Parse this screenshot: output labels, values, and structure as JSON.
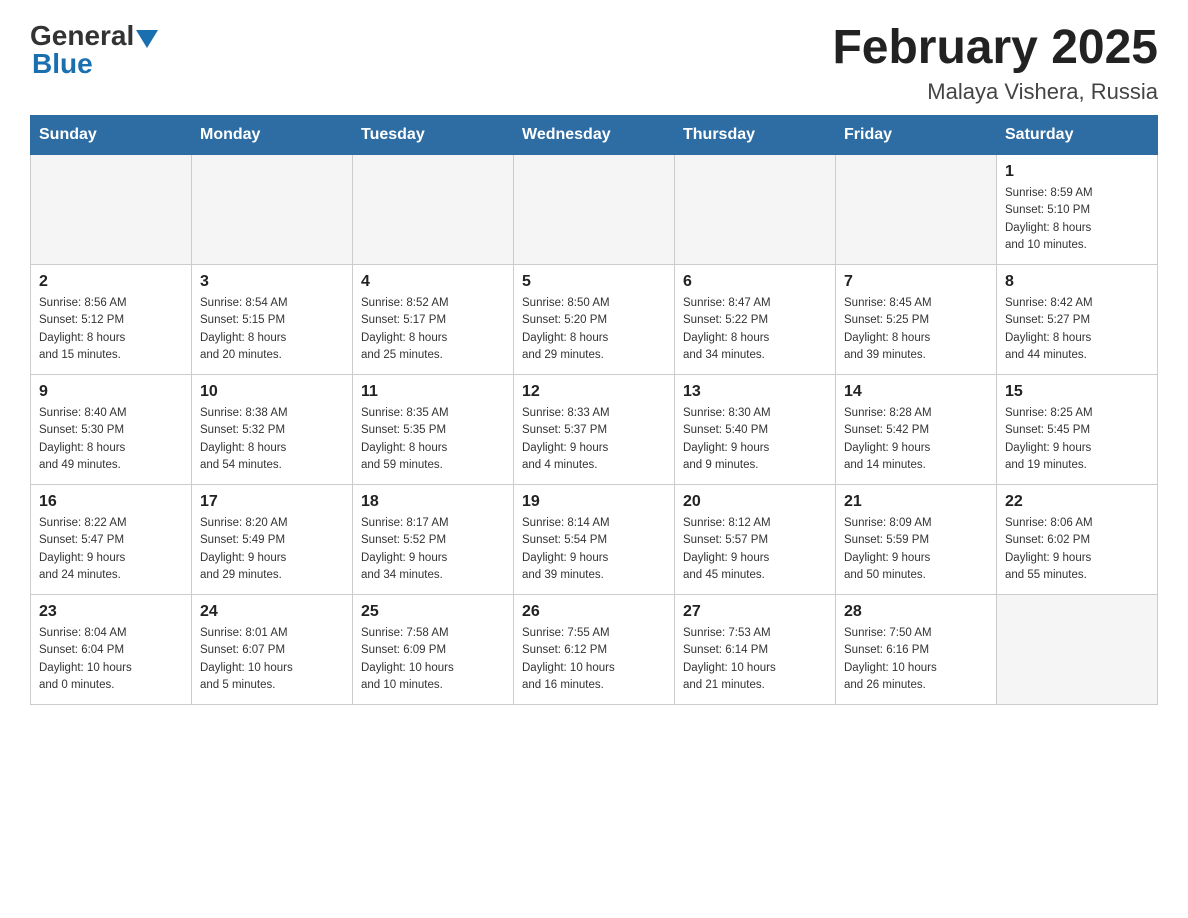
{
  "header": {
    "logo_general": "General",
    "logo_blue": "Blue",
    "month_title": "February 2025",
    "location": "Malaya Vishera, Russia"
  },
  "weekdays": [
    "Sunday",
    "Monday",
    "Tuesday",
    "Wednesday",
    "Thursday",
    "Friday",
    "Saturday"
  ],
  "weeks": [
    [
      {
        "day": "",
        "info": ""
      },
      {
        "day": "",
        "info": ""
      },
      {
        "day": "",
        "info": ""
      },
      {
        "day": "",
        "info": ""
      },
      {
        "day": "",
        "info": ""
      },
      {
        "day": "",
        "info": ""
      },
      {
        "day": "1",
        "info": "Sunrise: 8:59 AM\nSunset: 5:10 PM\nDaylight: 8 hours\nand 10 minutes."
      }
    ],
    [
      {
        "day": "2",
        "info": "Sunrise: 8:56 AM\nSunset: 5:12 PM\nDaylight: 8 hours\nand 15 minutes."
      },
      {
        "day": "3",
        "info": "Sunrise: 8:54 AM\nSunset: 5:15 PM\nDaylight: 8 hours\nand 20 minutes."
      },
      {
        "day": "4",
        "info": "Sunrise: 8:52 AM\nSunset: 5:17 PM\nDaylight: 8 hours\nand 25 minutes."
      },
      {
        "day": "5",
        "info": "Sunrise: 8:50 AM\nSunset: 5:20 PM\nDaylight: 8 hours\nand 29 minutes."
      },
      {
        "day": "6",
        "info": "Sunrise: 8:47 AM\nSunset: 5:22 PM\nDaylight: 8 hours\nand 34 minutes."
      },
      {
        "day": "7",
        "info": "Sunrise: 8:45 AM\nSunset: 5:25 PM\nDaylight: 8 hours\nand 39 minutes."
      },
      {
        "day": "8",
        "info": "Sunrise: 8:42 AM\nSunset: 5:27 PM\nDaylight: 8 hours\nand 44 minutes."
      }
    ],
    [
      {
        "day": "9",
        "info": "Sunrise: 8:40 AM\nSunset: 5:30 PM\nDaylight: 8 hours\nand 49 minutes."
      },
      {
        "day": "10",
        "info": "Sunrise: 8:38 AM\nSunset: 5:32 PM\nDaylight: 8 hours\nand 54 minutes."
      },
      {
        "day": "11",
        "info": "Sunrise: 8:35 AM\nSunset: 5:35 PM\nDaylight: 8 hours\nand 59 minutes."
      },
      {
        "day": "12",
        "info": "Sunrise: 8:33 AM\nSunset: 5:37 PM\nDaylight: 9 hours\nand 4 minutes."
      },
      {
        "day": "13",
        "info": "Sunrise: 8:30 AM\nSunset: 5:40 PM\nDaylight: 9 hours\nand 9 minutes."
      },
      {
        "day": "14",
        "info": "Sunrise: 8:28 AM\nSunset: 5:42 PM\nDaylight: 9 hours\nand 14 minutes."
      },
      {
        "day": "15",
        "info": "Sunrise: 8:25 AM\nSunset: 5:45 PM\nDaylight: 9 hours\nand 19 minutes."
      }
    ],
    [
      {
        "day": "16",
        "info": "Sunrise: 8:22 AM\nSunset: 5:47 PM\nDaylight: 9 hours\nand 24 minutes."
      },
      {
        "day": "17",
        "info": "Sunrise: 8:20 AM\nSunset: 5:49 PM\nDaylight: 9 hours\nand 29 minutes."
      },
      {
        "day": "18",
        "info": "Sunrise: 8:17 AM\nSunset: 5:52 PM\nDaylight: 9 hours\nand 34 minutes."
      },
      {
        "day": "19",
        "info": "Sunrise: 8:14 AM\nSunset: 5:54 PM\nDaylight: 9 hours\nand 39 minutes."
      },
      {
        "day": "20",
        "info": "Sunrise: 8:12 AM\nSunset: 5:57 PM\nDaylight: 9 hours\nand 45 minutes."
      },
      {
        "day": "21",
        "info": "Sunrise: 8:09 AM\nSunset: 5:59 PM\nDaylight: 9 hours\nand 50 minutes."
      },
      {
        "day": "22",
        "info": "Sunrise: 8:06 AM\nSunset: 6:02 PM\nDaylight: 9 hours\nand 55 minutes."
      }
    ],
    [
      {
        "day": "23",
        "info": "Sunrise: 8:04 AM\nSunset: 6:04 PM\nDaylight: 10 hours\nand 0 minutes."
      },
      {
        "day": "24",
        "info": "Sunrise: 8:01 AM\nSunset: 6:07 PM\nDaylight: 10 hours\nand 5 minutes."
      },
      {
        "day": "25",
        "info": "Sunrise: 7:58 AM\nSunset: 6:09 PM\nDaylight: 10 hours\nand 10 minutes."
      },
      {
        "day": "26",
        "info": "Sunrise: 7:55 AM\nSunset: 6:12 PM\nDaylight: 10 hours\nand 16 minutes."
      },
      {
        "day": "27",
        "info": "Sunrise: 7:53 AM\nSunset: 6:14 PM\nDaylight: 10 hours\nand 21 minutes."
      },
      {
        "day": "28",
        "info": "Sunrise: 7:50 AM\nSunset: 6:16 PM\nDaylight: 10 hours\nand 26 minutes."
      },
      {
        "day": "",
        "info": ""
      }
    ]
  ]
}
